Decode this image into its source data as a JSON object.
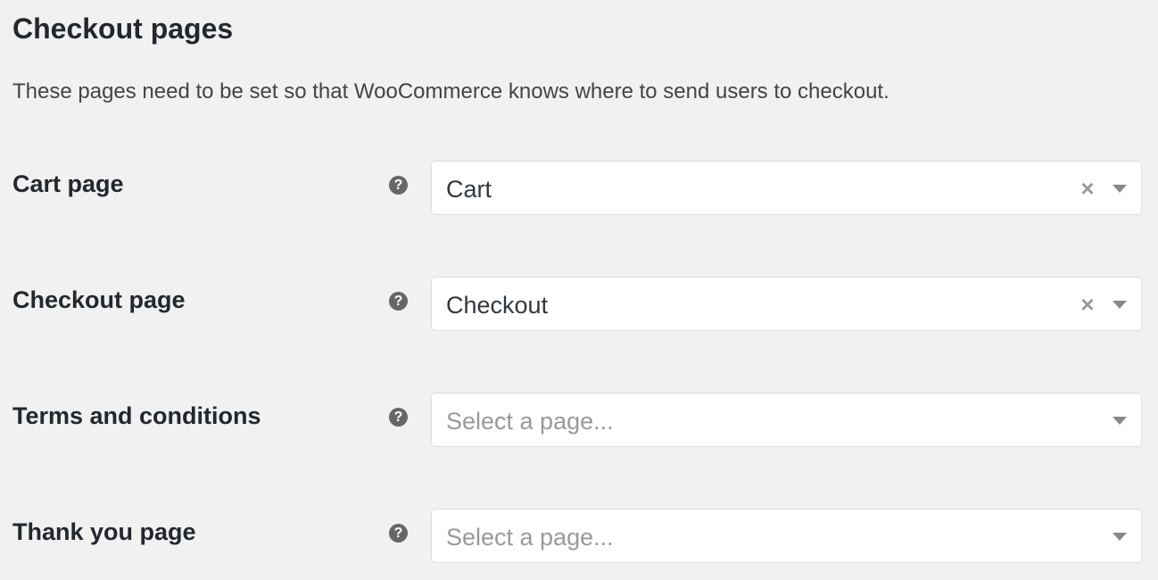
{
  "section": {
    "title": "Checkout pages",
    "description": "These pages need to be set so that WooCommerce knows where to send users to checkout."
  },
  "help_icon_glyph": "?",
  "clear_icon_glyph": "×",
  "settings": [
    {
      "label": "Cart page",
      "value": "Cart",
      "placeholder": "Select a page…",
      "has_value": true,
      "icon": "help-icon"
    },
    {
      "label": "Checkout page",
      "value": "Checkout",
      "placeholder": "Select a page…",
      "has_value": true,
      "icon": "help-icon"
    },
    {
      "label": "Terms and conditions",
      "value": "",
      "placeholder": "Select a page...",
      "has_value": false,
      "icon": "help-icon"
    },
    {
      "label": "Thank you page",
      "value": "",
      "placeholder": "Select a page...",
      "has_value": false,
      "icon": "help-icon"
    }
  ],
  "colors": {
    "background": "#f1f1f1",
    "help_icon_bg": "#666666",
    "placeholder_text": "#999999",
    "select_border": "#dddddd"
  }
}
